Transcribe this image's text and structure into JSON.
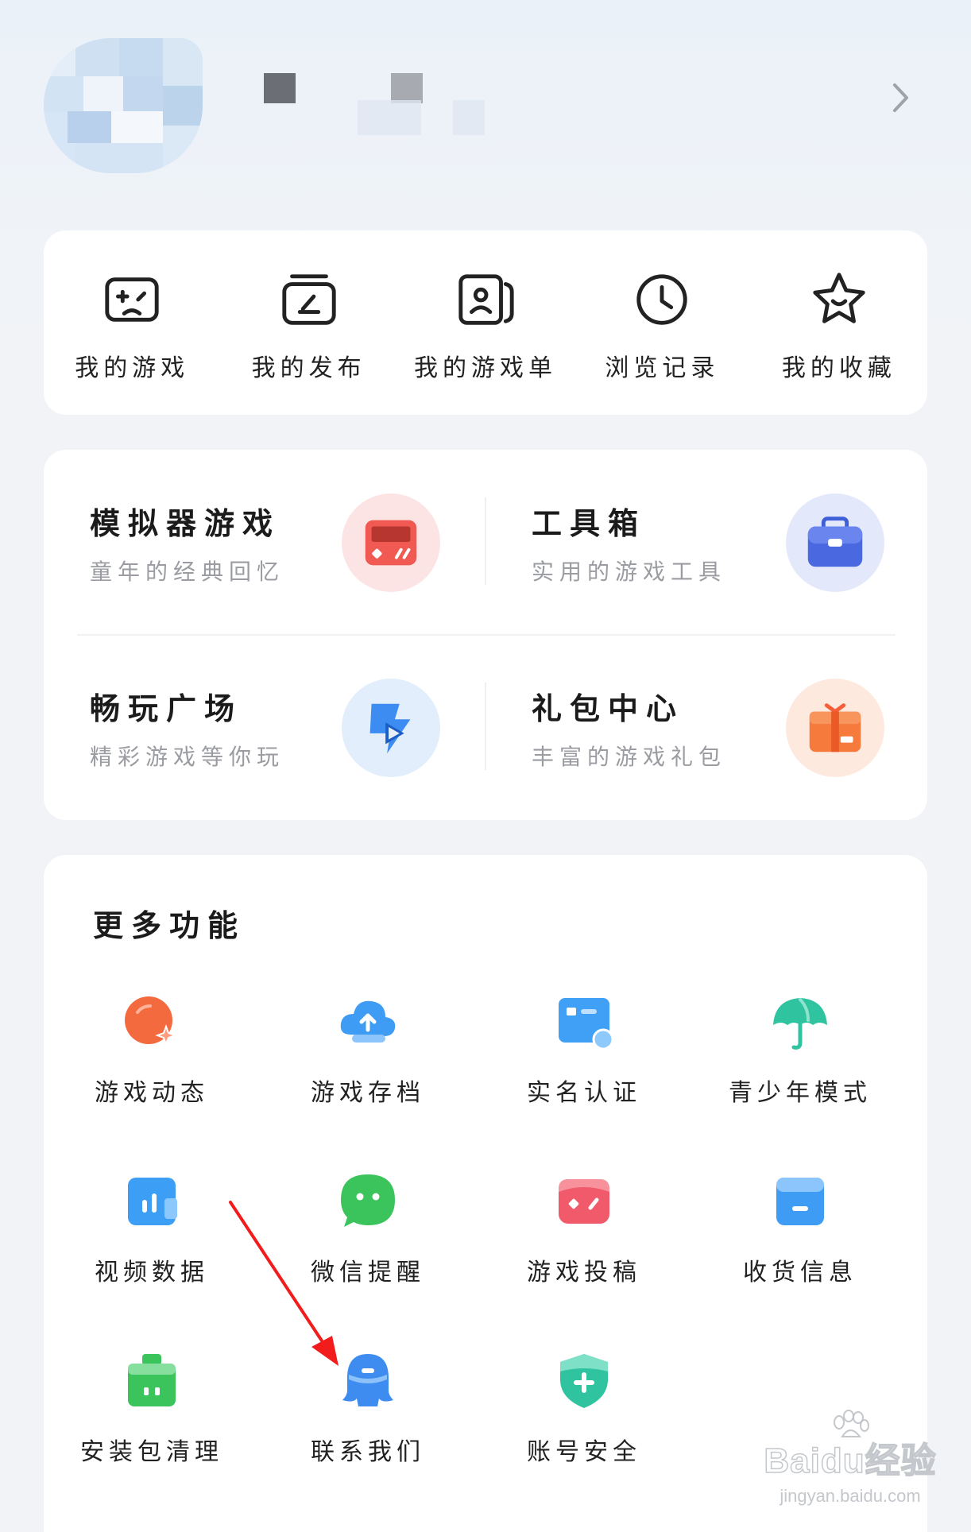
{
  "profile": {
    "chevron_icon": "chevron-right-icon"
  },
  "quick_actions": [
    {
      "label": "我的游戏",
      "icon": "gamepad-icon"
    },
    {
      "label": "我的发布",
      "icon": "publish-icon"
    },
    {
      "label": "我的游戏单",
      "icon": "game-list-icon"
    },
    {
      "label": "浏览记录",
      "icon": "clock-icon"
    },
    {
      "label": "我的收藏",
      "icon": "star-icon"
    }
  ],
  "features": [
    {
      "title": "模拟器游戏",
      "subtitle": "童年的经典回忆",
      "icon": "emulator-icon",
      "color": "#f05a52"
    },
    {
      "title": "工具箱",
      "subtitle": "实用的游戏工具",
      "icon": "toolbox-icon",
      "color": "#4a68e0"
    },
    {
      "title": "畅玩广场",
      "subtitle": "精彩游戏等你玩",
      "icon": "play-square-icon",
      "color": "#3c8cf2"
    },
    {
      "title": "礼包中心",
      "subtitle": "丰富的游戏礼包",
      "icon": "gift-icon",
      "color": "#f57a3c"
    }
  ],
  "more": {
    "title": "更多功能",
    "items": [
      {
        "label": "游戏动态",
        "icon": "game-news-icon",
        "color": "#f36a3e"
      },
      {
        "label": "游戏存档",
        "icon": "cloud-save-icon",
        "color": "#3f9cf5"
      },
      {
        "label": "实名认证",
        "icon": "id-card-icon",
        "color": "#3fa0f5"
      },
      {
        "label": "青少年模式",
        "icon": "umbrella-icon",
        "color": "#2fc3a0"
      },
      {
        "label": "视频数据",
        "icon": "video-stats-icon",
        "color": "#3c9ff5"
      },
      {
        "label": "微信提醒",
        "icon": "wechat-icon",
        "color": "#3cc45c"
      },
      {
        "label": "游戏投稿",
        "icon": "game-submit-icon",
        "color": "#f05a6a"
      },
      {
        "label": "收货信息",
        "icon": "address-icon",
        "color": "#3f9cf5"
      },
      {
        "label": "安装包清理",
        "icon": "cleanup-icon",
        "color": "#3cc45c"
      },
      {
        "label": "联系我们",
        "icon": "contact-icon",
        "color": "#3f8cf0"
      },
      {
        "label": "账号安全",
        "icon": "shield-icon",
        "color": "#2fc3a0"
      }
    ]
  },
  "watermark": {
    "logo": "Baidu经验",
    "url": "jingyan.baidu.com"
  }
}
